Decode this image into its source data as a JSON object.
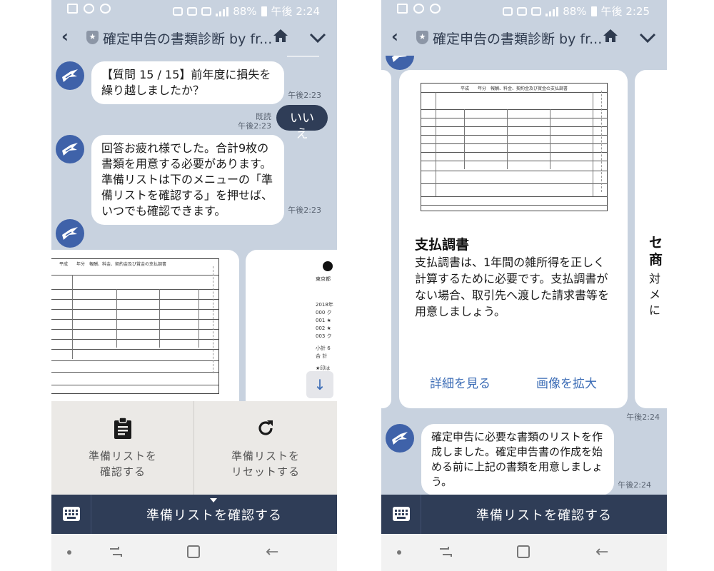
{
  "left": {
    "status": {
      "battery": "88%",
      "time": "午後 2:24"
    },
    "header": {
      "title": "確定申告の書類診断 by fr..."
    },
    "messages": {
      "q15": "【質問 15 / 15】前年度に損失を繰り越しましたか？",
      "q15_time": "午後2:23",
      "answer": "いいえ",
      "read": "既読",
      "answer_time": "午後2:23",
      "done": "回答お疲れ様でした。合計9枚の書類を用意する必要があります。準備リストは下のメニューの「準備リストを確認する」を押せば、いつでも確認できます。",
      "done_time": "午後2:23"
    },
    "doc": {
      "heading": "平成　　年分　報酬、料金、契約金及び賞金の支払調書"
    },
    "receipt": {
      "l1": "東京都",
      "l2": "2018年",
      "l3": "000 ク",
      "l4": "001 ★",
      "l5": "002 ★",
      "l6": "003 ク",
      "l7": "小計 6",
      "l8": "合 計",
      "l9": "★印は"
    },
    "menu": {
      "item1_line1": "準備リストを",
      "item1_line2": "確認する",
      "item2_line1": "準備リストを",
      "item2_line2": "リセットする"
    },
    "bottom": {
      "label": "準備リストを確認する"
    }
  },
  "right": {
    "status": {
      "battery": "88%",
      "time": "午後 2:25"
    },
    "header": {
      "title": "確定申告の書類診断 by fr..."
    },
    "doc": {
      "heading": "平成　　年分　報酬、料金、契約金及び賞金の支払調書"
    },
    "card": {
      "title": "支払調書",
      "body": "支払調書は、1年間の雑所得を正しく計算するために必要です。支払調書がない場合、取引先へ渡した請求書等を用意しましょう。",
      "link_detail": "詳細を見る",
      "link_zoom": "画像を拡大"
    },
    "next_card": {
      "t1": "セ",
      "t2": "商",
      "b1": "対",
      "b2": "メ",
      "b3": "に"
    },
    "card_time": "午後2:24",
    "messages": {
      "created": "確定申告に必要な書類のリストを作成しました。確定申告書の作成を始める前に上記の書類を用意しましょう。",
      "created_time": "午後2:24"
    },
    "bottom": {
      "label": "準備リストを確認する"
    }
  },
  "colors": {
    "chat_bg": "#c8d2df",
    "avatar": "#3f62a9",
    "my_bubble": "#2f3d57",
    "bottom_bar": "#2f3d57",
    "link": "#3a6bb5"
  }
}
